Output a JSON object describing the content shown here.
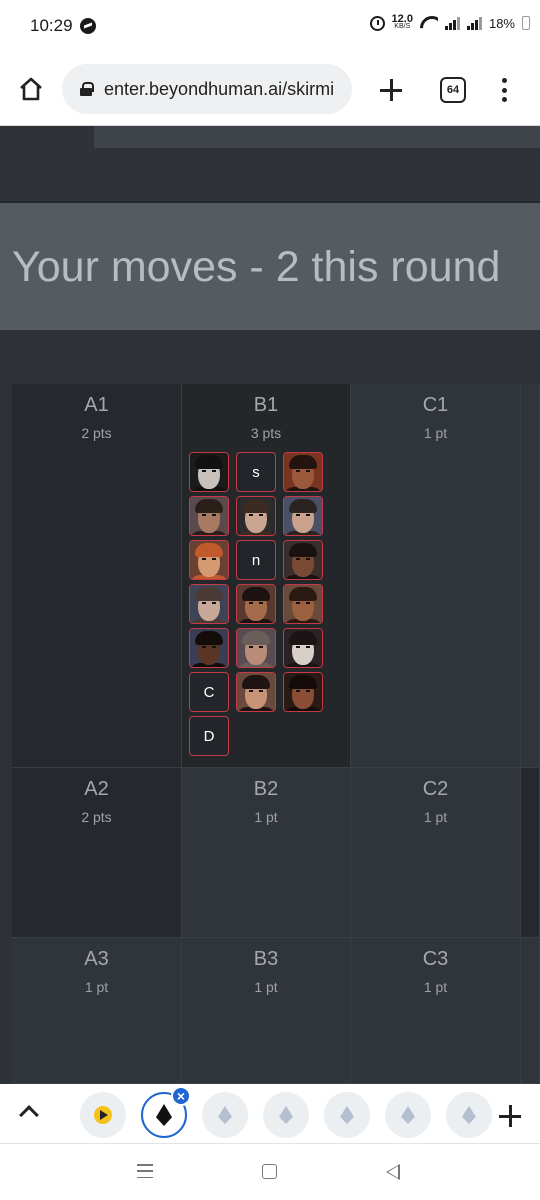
{
  "status": {
    "time": "10:29",
    "net_speed_value": "12.0",
    "net_speed_unit": "KB/S",
    "battery": "18%"
  },
  "browser": {
    "url": "enter.beyondhuman.ai/skirmi",
    "tab_count": "64"
  },
  "page": {
    "moves_title": "Your moves - 2 this round"
  },
  "board": {
    "cells": [
      {
        "name": "A1",
        "pts": "2 pts"
      },
      {
        "name": "B1",
        "pts": "3 pts"
      },
      {
        "name": "C1",
        "pts": "1 pt"
      },
      {
        "name": "A2",
        "pts": "2 pts"
      },
      {
        "name": "B2",
        "pts": "1 pt"
      },
      {
        "name": "C2",
        "pts": "1 pt"
      },
      {
        "name": "A3",
        "pts": "1 pt"
      },
      {
        "name": "B3",
        "pts": "1 pt"
      },
      {
        "name": "C3",
        "pts": "1 pt"
      }
    ],
    "b1_pieces": [
      {
        "kind": "avatar",
        "skin": "#c9c1bb",
        "hair": "#111111",
        "bg": "#1b1b1b"
      },
      {
        "kind": "letter",
        "label": "s"
      },
      {
        "kind": "avatar",
        "skin": "#9b5a3c",
        "hair": "#241410",
        "bg": "#7a3522"
      },
      {
        "kind": "avatar",
        "skin": "#a97a62",
        "hair": "#2a1e19",
        "bg": "#5a4a4e"
      },
      {
        "kind": "avatar",
        "skin": "#c9a48e",
        "hair": "#3a2a22",
        "bg": "#2b2b2e"
      },
      {
        "kind": "avatar",
        "skin": "#c8a28c",
        "hair": "#2a2320",
        "bg": "#4a5068"
      },
      {
        "kind": "avatar",
        "skin": "#d49a72",
        "hair": "#c05a2a",
        "bg": "#6a4032"
      },
      {
        "kind": "letter",
        "label": "n"
      },
      {
        "kind": "avatar",
        "skin": "#7a4a34",
        "hair": "#1a1210",
        "bg": "#3a2e2c"
      },
      {
        "kind": "avatar",
        "skin": "#c8a898",
        "hair": "#4a3a36",
        "bg": "#3e4456"
      },
      {
        "kind": "avatar",
        "skin": "#a56c4c",
        "hair": "#1c1310",
        "bg": "#5a3a30"
      },
      {
        "kind": "avatar",
        "skin": "#9a6040",
        "hair": "#2a1a12",
        "bg": "#6a4a3a"
      },
      {
        "kind": "avatar",
        "skin": "#5a3424",
        "hair": "#140c0a",
        "bg": "#3a3e54"
      },
      {
        "kind": "avatar",
        "skin": "#b88c78",
        "hair": "#6a5e5a",
        "bg": "#5a4a52"
      },
      {
        "kind": "avatar",
        "skin": "#d8cfc8",
        "hair": "#1a1414",
        "bg": "#2a2224"
      },
      {
        "kind": "letter",
        "label": "C"
      },
      {
        "kind": "avatar",
        "skin": "#c89478",
        "hair": "#1e1412",
        "bg": "#6a4a3e"
      },
      {
        "kind": "avatar",
        "skin": "#8a4e36",
        "hair": "#140c0a",
        "bg": "#2a1a16"
      },
      {
        "kind": "letter",
        "label": "D"
      }
    ]
  },
  "tab_strip": {
    "bubbles": [
      {
        "name": "tab-bubble-play",
        "icon": "play-circle-icon",
        "kind": "play"
      },
      {
        "name": "tab-bubble-active",
        "icon": "beyondhuman-logo-icon",
        "kind": "active"
      },
      {
        "name": "tab-bubble-3",
        "icon": "beyondhuman-logo-icon",
        "kind": "plain"
      },
      {
        "name": "tab-bubble-4",
        "icon": "beyondhuman-logo-icon",
        "kind": "plain"
      },
      {
        "name": "tab-bubble-5",
        "icon": "beyondhuman-logo-icon",
        "kind": "plain"
      },
      {
        "name": "tab-bubble-6",
        "icon": "beyondhuman-logo-icon",
        "kind": "plain"
      },
      {
        "name": "tab-bubble-7",
        "icon": "beyondhuman-logo-icon",
        "kind": "plain"
      }
    ],
    "close_glyph": "×"
  },
  "colors": {
    "accent_blue": "#1f66d1",
    "piece_border": "#c53a48",
    "banner_bg": "#545b61",
    "board_bg": "#30353a"
  }
}
